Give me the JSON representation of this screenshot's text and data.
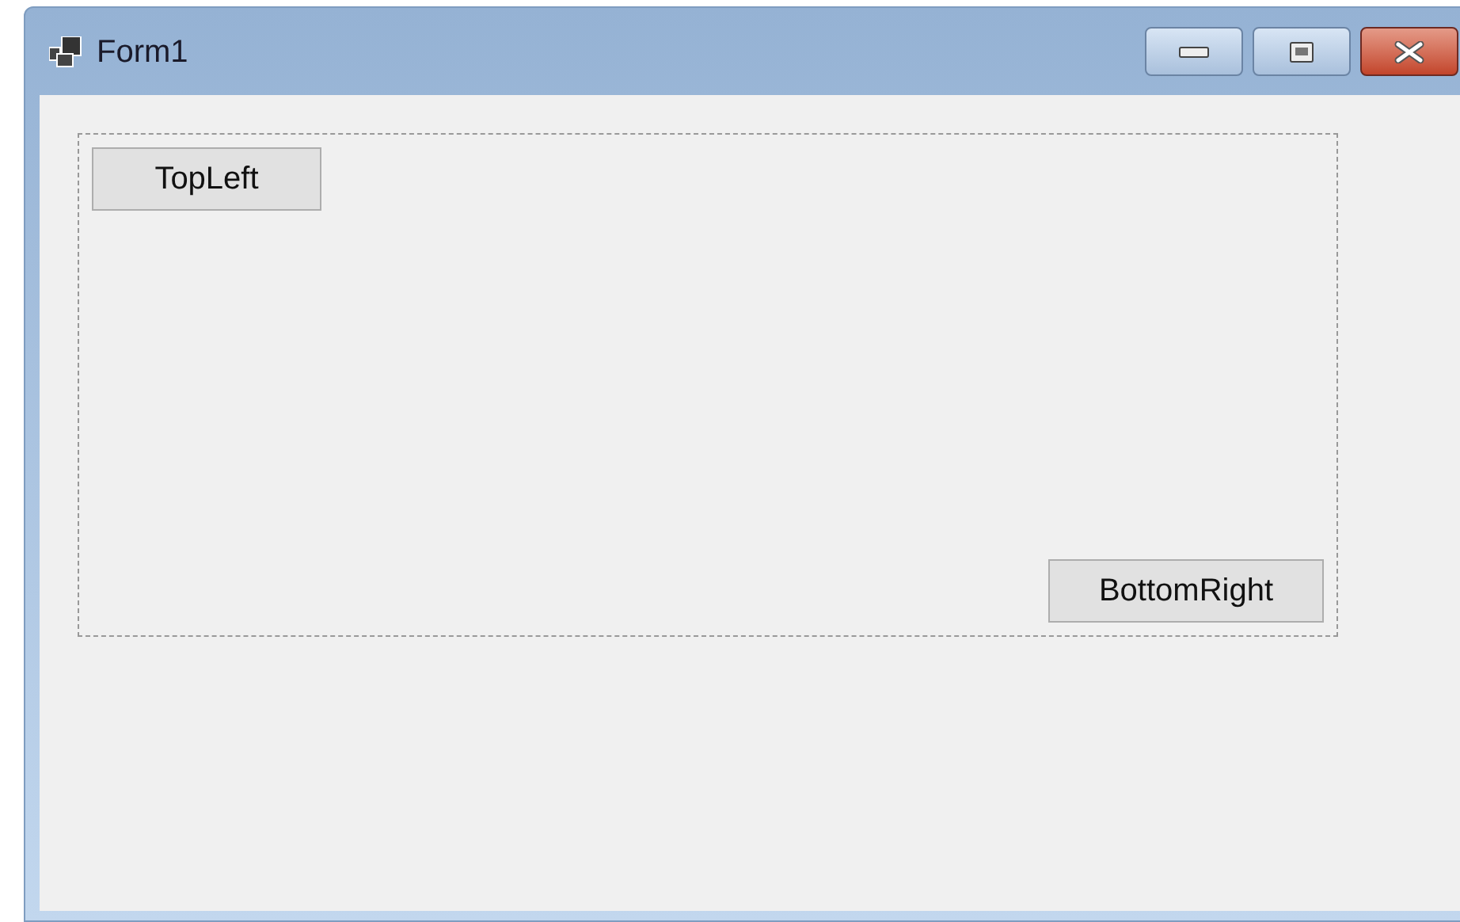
{
  "window": {
    "title": "Form1"
  },
  "panel": {
    "buttons": [
      {
        "label": "TopLeft"
      },
      {
        "label": "BottomRight"
      }
    ]
  }
}
